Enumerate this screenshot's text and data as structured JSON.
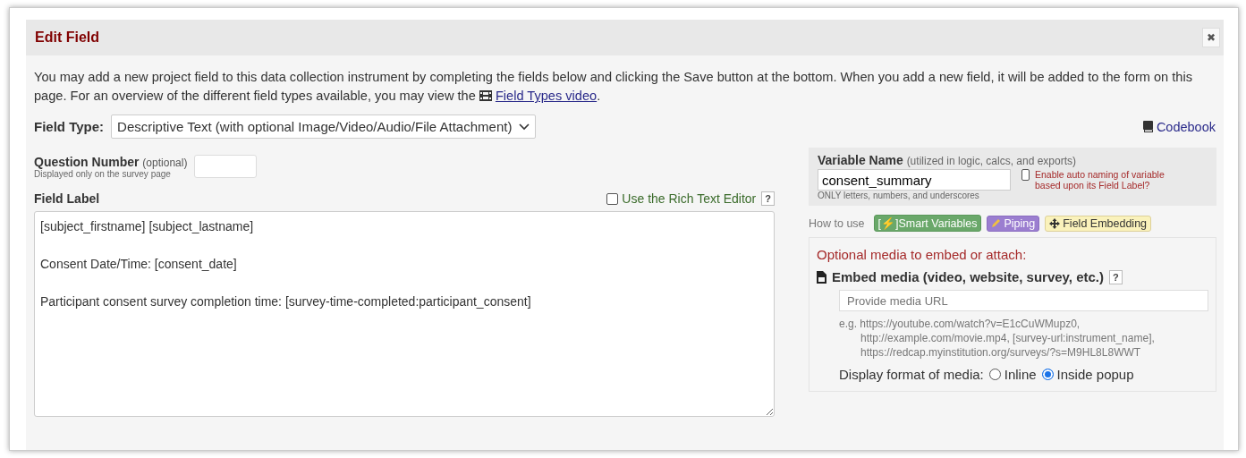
{
  "dialog": {
    "title": "Edit Field",
    "close_label": "✖"
  },
  "intro": {
    "text": "You may add a new project field to this data collection instrument by completing the fields below and clicking the Save button at the bottom. When you add a new field, it will be added to the form on this page. For an overview of the different field types available, you may view the",
    "link": "Field Types video",
    "after": "."
  },
  "field_type": {
    "label": "Field Type:",
    "value": "Descriptive Text (with optional Image/Video/Audio/File Attachment)"
  },
  "codebook": {
    "label": "Codebook"
  },
  "question_number": {
    "label": "Question Number",
    "optional": "(optional)",
    "hint": "Displayed only on the survey page"
  },
  "field_label": {
    "label": "Field Label",
    "rich_text": {
      "label": "Use the Rich Text Editor",
      "checked": false
    },
    "help": "?",
    "lines": [
      "[subject_firstname] [subject_lastname]",
      "Consent Date/Time: [consent_date]",
      "Participant consent survey completion time: [survey-time-completed:participant_consent]"
    ]
  },
  "variable_name": {
    "label": "Variable Name",
    "note": "(utilized in logic, calcs, and exports)",
    "value": "consent_summary",
    "hint": "ONLY letters, numbers, and underscores",
    "auto_naming": {
      "label": "Enable auto naming of variable based upon its Field Label?",
      "checked": false
    }
  },
  "how_to_use": {
    "label": "How to use",
    "buttons": [
      {
        "kind": "smart",
        "icon": "[⚡]",
        "label": "Smart Variables"
      },
      {
        "kind": "piping",
        "label": "Piping"
      },
      {
        "kind": "embedding",
        "label": "Field Embedding"
      }
    ]
  },
  "media": {
    "title": "Optional media to embed or attach:",
    "embed_label": "Embed media (video, website, survey, etc.)",
    "help": "?",
    "url_placeholder": "Provide media URL",
    "examples": [
      "e.g. https://youtube.com/watch?v=E1cCuWMupz0,",
      "http://example.com/movie.mp4, [survey-url:instrument_name],",
      "https://redcap.myinstitution.org/surveys/?s=M9HL8L8WWT"
    ],
    "display_label": "Display format of media:",
    "display_options": [
      {
        "label": "Inline",
        "selected": false
      },
      {
        "label": "Inside popup",
        "selected": true
      }
    ]
  }
}
